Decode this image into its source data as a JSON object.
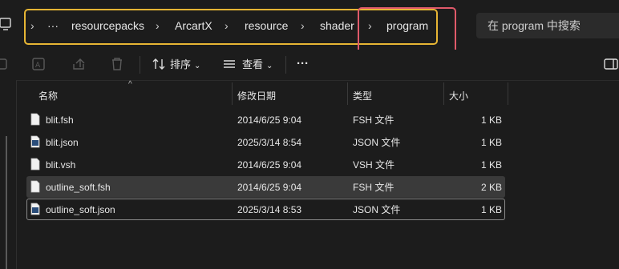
{
  "address": {
    "crumbs": [
      "···",
      "resourcepacks",
      "ArcartX",
      "resource",
      "shader",
      "program"
    ],
    "search_placeholder": "在 program 中搜索"
  },
  "toolbar": {
    "sort_label": "排序",
    "view_label": "查看",
    "more_label": "···"
  },
  "columns": {
    "name": "名称",
    "modified": "修改日期",
    "type": "类型",
    "size": "大小"
  },
  "files": [
    {
      "name": "blit.fsh",
      "modified": "2014/6/25 9:04",
      "type": "FSH 文件",
      "size": "1 KB",
      "icon": "doc-icon"
    },
    {
      "name": "blit.json",
      "modified": "2025/3/14 8:54",
      "type": "JSON 文件",
      "size": "1 KB",
      "icon": "json-icon"
    },
    {
      "name": "blit.vsh",
      "modified": "2014/6/25 9:04",
      "type": "VSH 文件",
      "size": "1 KB",
      "icon": "doc-icon"
    },
    {
      "name": "outline_soft.fsh",
      "modified": "2014/6/25 9:04",
      "type": "FSH 文件",
      "size": "2 KB",
      "icon": "doc-icon"
    },
    {
      "name": "outline_soft.json",
      "modified": "2025/3/14 8:53",
      "type": "JSON 文件",
      "size": "1 KB",
      "icon": "json-icon"
    }
  ]
}
